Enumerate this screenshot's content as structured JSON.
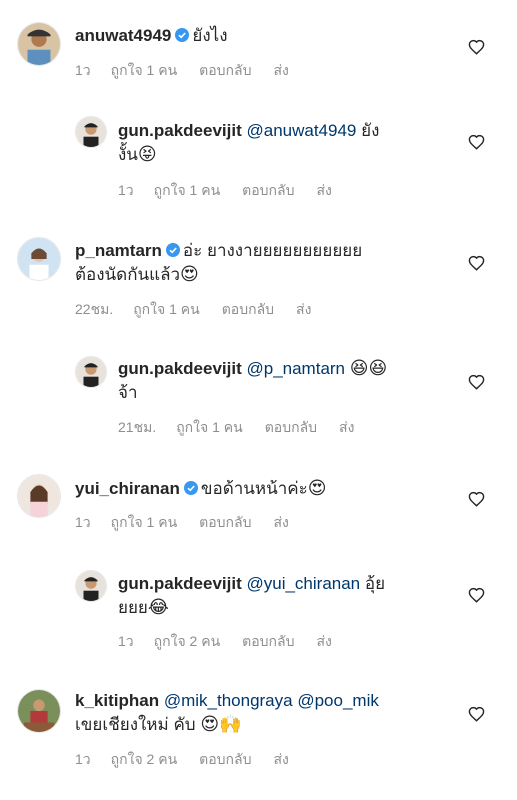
{
  "comments": [
    {
      "username": "anuwat4949",
      "verified": true,
      "line1": "ยังไง",
      "line2": "",
      "age": "1ว",
      "likes": "ถูกใจ 1 คน",
      "reply": "ตอบกลับ",
      "send": "ส่ง",
      "avatar_icon": "avatar-photo"
    },
    {
      "username": "gun.pakdeevijit",
      "mention": "@anuwat4949",
      "line1_suffix": "ยัง",
      "line2": "งั้น",
      "emoji": "😝",
      "age": "1ว",
      "likes": "ถูกใจ 1 คน",
      "reply": "ตอบกลับ",
      "send": "ส่ง"
    },
    {
      "username": "p_namtarn",
      "verified": true,
      "line1": "อ่ะ ยางงายยยยยยยยยยย",
      "line2": "ต้องนัดกันแล้ว",
      "emoji": "😍",
      "age": "22ชม.",
      "likes": "ถูกใจ 1 คน",
      "reply": "ตอบกลับ",
      "send": "ส่ง"
    },
    {
      "username": "gun.pakdeevijit",
      "mention": "@p_namtarn",
      "emoji_inline": "😆😆",
      "line2": "จ้า",
      "age": "21ชม.",
      "likes": "ถูกใจ 1 คน",
      "reply": "ตอบกลับ",
      "send": "ส่ง"
    },
    {
      "username": "yui_chiranan",
      "verified": true,
      "line1": "ขอด้านหน้าค่ะ",
      "emoji": "😍",
      "age": "1ว",
      "likes": "ถูกใจ 1 คน",
      "reply": "ตอบกลับ",
      "send": "ส่ง"
    },
    {
      "username": "gun.pakdeevijit",
      "mention": "@yui_chiranan",
      "line1_suffix": "อุ้ย",
      "line2": "ยยย",
      "emoji": "😂",
      "age": "1ว",
      "likes": "ถูกใจ 2 คน",
      "reply": "ตอบกลับ",
      "send": "ส่ง"
    },
    {
      "username": "k_kitiphan",
      "mention": "@mik_thongraya",
      "mention2": "@poo_mik",
      "line2": "เขยเชียงใหม่ คับ",
      "emoji": "😍🙌",
      "age": "1ว",
      "likes": "ถูกใจ 2 คน",
      "reply": "ตอบกลับ",
      "send": "ส่ง"
    }
  ],
  "colors": {
    "text": "#262626",
    "meta": "#8e8e8e",
    "mention": "#00376b",
    "verified": "#3897f0"
  }
}
